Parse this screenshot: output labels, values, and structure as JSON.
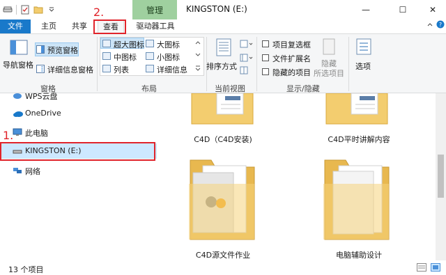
{
  "window": {
    "title": "KINGSTON (E:)",
    "context_tab": "管理",
    "minimize": "—",
    "maximize": "☐",
    "close": "✕"
  },
  "tabs": {
    "file": "文件",
    "home": "主页",
    "share": "共享",
    "view": "查看",
    "drive_tools": "驱动器工具"
  },
  "annotations": {
    "step1": "1.",
    "step2": "2."
  },
  "ribbon": {
    "panes": {
      "nav_pane": "导航窗格",
      "preview_pane": "预览窗格",
      "details_pane": "详细信息窗格",
      "label": "窗格"
    },
    "layout": {
      "extra_large_icons": "超大图标",
      "large_icons": "大图标",
      "medium_icons": "中图标",
      "small_icons": "小图标",
      "list": "列表",
      "details": "详细信息",
      "label": "布局"
    },
    "current_view": {
      "sort_by": "排序方式",
      "label": "当前视图"
    },
    "show_hide": {
      "item_checkboxes": "项目复选框",
      "file_extensions": "文件扩展名",
      "hidden_items": "隐藏的项目",
      "hide": "隐藏",
      "selected_items": "所选项目",
      "label": "显示/隐藏"
    },
    "options": "选项"
  },
  "nav": {
    "items": [
      {
        "label": "WPS云盘"
      },
      {
        "label": "OneDrive"
      },
      {
        "label": "此电脑"
      },
      {
        "label": "KINGSTON (E:)"
      },
      {
        "label": "网络"
      }
    ]
  },
  "content": {
    "items": [
      {
        "label": "C4D（C4D安装)"
      },
      {
        "label": "C4D平时讲解内容"
      },
      {
        "label": "C4D源文件作业"
      },
      {
        "label": "电脑辅助设计"
      }
    ]
  },
  "status": {
    "count": "13 个项目"
  },
  "colors": {
    "accent": "#1979ca",
    "context_tab": "#9fd09f",
    "annotation_red": "#e0242b",
    "selection": "#cde8ff",
    "folder": "#f3cd6f"
  }
}
